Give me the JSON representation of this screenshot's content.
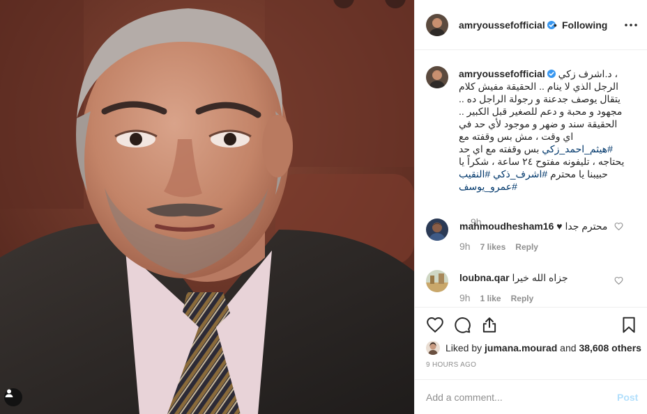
{
  "post": {
    "author": {
      "username": "amryoussefofficial",
      "verified": true,
      "follow_state": "Following",
      "separator": "•"
    },
    "caption": {
      "lines": [
        "د.اشرف زكي ،",
        "الرجل الذي لا ينام .. الحقيقة مفيش كلام",
        "يتقال يوصف جدعنة و رجولة الراجل ده ..",
        "مجهود و محبة و دعم للصغير قبل الكبير ..",
        "الحقيقة سند و ضهر و موجود لأي حد في",
        "اي وقت ، مش بس وقفته مع"
      ],
      "line7_tag": "#هيثم_احمد_زكي",
      "line7_rest": " بس وقفته مع اي حد",
      "line8": "يحتاجه ، تليفونه مفتوح ٢٤ ساعة ، شكراً يا",
      "line9_text": "حبيبنا يا محترم ",
      "line9_tag1": "#اشرف_ذكي",
      "line9_space": " ",
      "line9_tag2": "#النقيب",
      "line10_tag": "#عمرو_يوسف",
      "time": "9h"
    },
    "comments": [
      {
        "username": "mahmoudhesham16",
        "text": "محترم جدا ♥",
        "time": "9h",
        "likes": "7 likes",
        "reply": "Reply"
      },
      {
        "username": "loubna.qar",
        "text": "جزاه الله خيرا",
        "time": "9h",
        "likes": "1 like",
        "reply": "Reply"
      }
    ],
    "liked_by": {
      "prefix": "Liked by ",
      "user": "jumana.mourad",
      "middle": " and ",
      "others": "38,608 others"
    },
    "age": "9 HOURS AGO",
    "add_comment": {
      "placeholder": "Add a comment...",
      "post_label": "Post"
    }
  },
  "icons": {
    "verified": "verified-badge-icon",
    "more": "more-options-icon",
    "like": "heart-icon",
    "comment": "comment-bubble-icon",
    "share": "share-icon",
    "save": "bookmark-icon",
    "user_tags": "user-tag-icon"
  },
  "colors": {
    "verified": "#3897f0",
    "link": "#00376b",
    "muted": "#8e8e8e",
    "post_disabled": "#b2dffc"
  }
}
